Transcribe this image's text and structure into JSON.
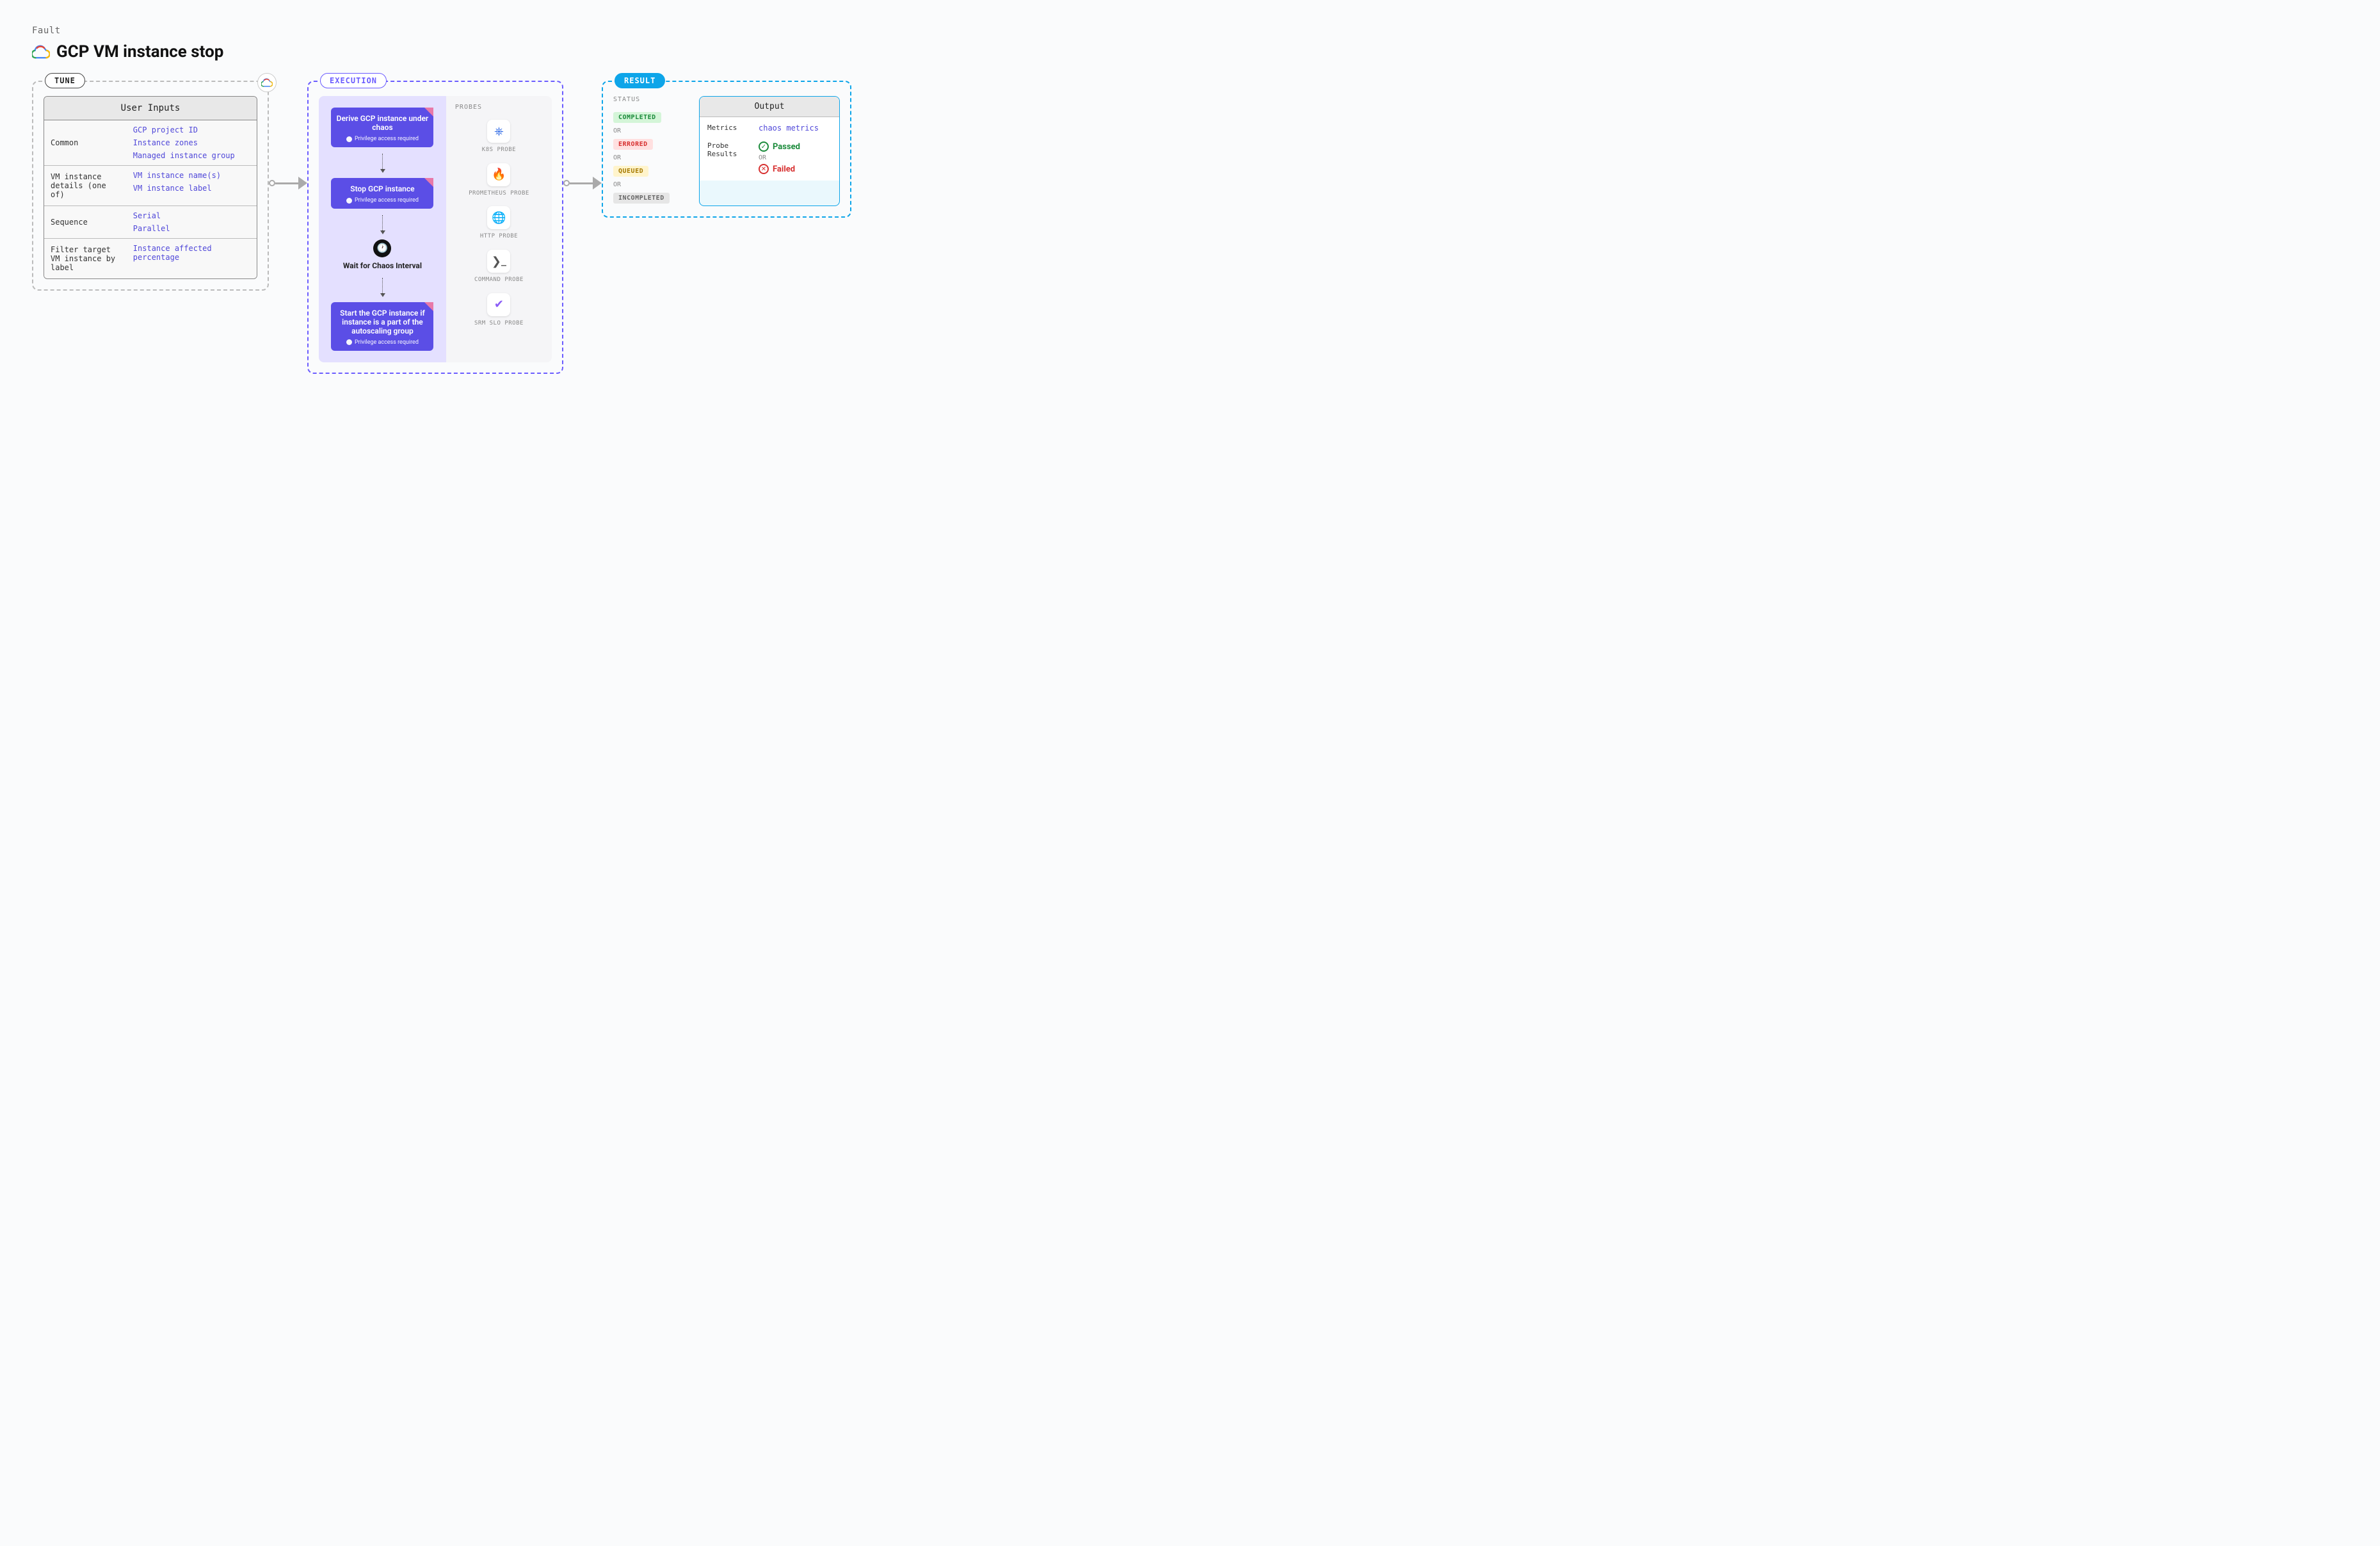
{
  "fault_label": "Fault",
  "title": "GCP VM instance stop",
  "tune": {
    "tab": "TUNE",
    "inputs_header": "User Inputs",
    "rows": [
      {
        "key": "Common",
        "values": [
          "GCP project ID",
          "Instance zones",
          "Managed instance group"
        ]
      },
      {
        "key": "VM instance details (one of)",
        "values": [
          "VM instance name(s)",
          "VM instance label"
        ]
      },
      {
        "key": "Sequence",
        "values": [
          "Serial",
          "Parallel"
        ]
      },
      {
        "key": "Filter target VM instance by label",
        "values": [
          "Instance affected percentage"
        ]
      }
    ]
  },
  "execution": {
    "tab": "EXECUTION",
    "steps": [
      {
        "label": "Derive GCP instance under chaos",
        "priv": "Privilege access required",
        "privileged": true
      },
      {
        "label": "Stop GCP instance",
        "priv": "Privilege access required",
        "privileged": true
      }
    ],
    "wait_label": "Wait for Chaos Interval",
    "final_step": {
      "label": "Start the GCP instance if instance is a part of the autoscaling group",
      "priv": "Privilege access required",
      "privileged": true
    },
    "probes_label": "PROBES",
    "probes": [
      {
        "label": "K8S PROBE",
        "icon": "k8s",
        "color": "#326ce5"
      },
      {
        "label": "PROMETHEUS PROBE",
        "icon": "prom",
        "color": "#e6522c"
      },
      {
        "label": "HTTP PROBE",
        "icon": "http",
        "color": "#3b82f6"
      },
      {
        "label": "COMMAND PROBE",
        "icon": "cmd",
        "color": "#555"
      },
      {
        "label": "SRM SLO PROBE",
        "icon": "slo",
        "color": "#8b5cf6"
      }
    ]
  },
  "result": {
    "tab": "RESULT",
    "status_label": "STATUS",
    "or": "OR",
    "statuses": [
      "COMPLETED",
      "ERRORED",
      "QUEUED",
      "INCOMPLETED"
    ],
    "output_header": "Output",
    "metrics_key": "Metrics",
    "metrics_val": "chaos metrics",
    "probe_results_key": "Probe Results",
    "passed": "Passed",
    "failed": "Failed"
  }
}
